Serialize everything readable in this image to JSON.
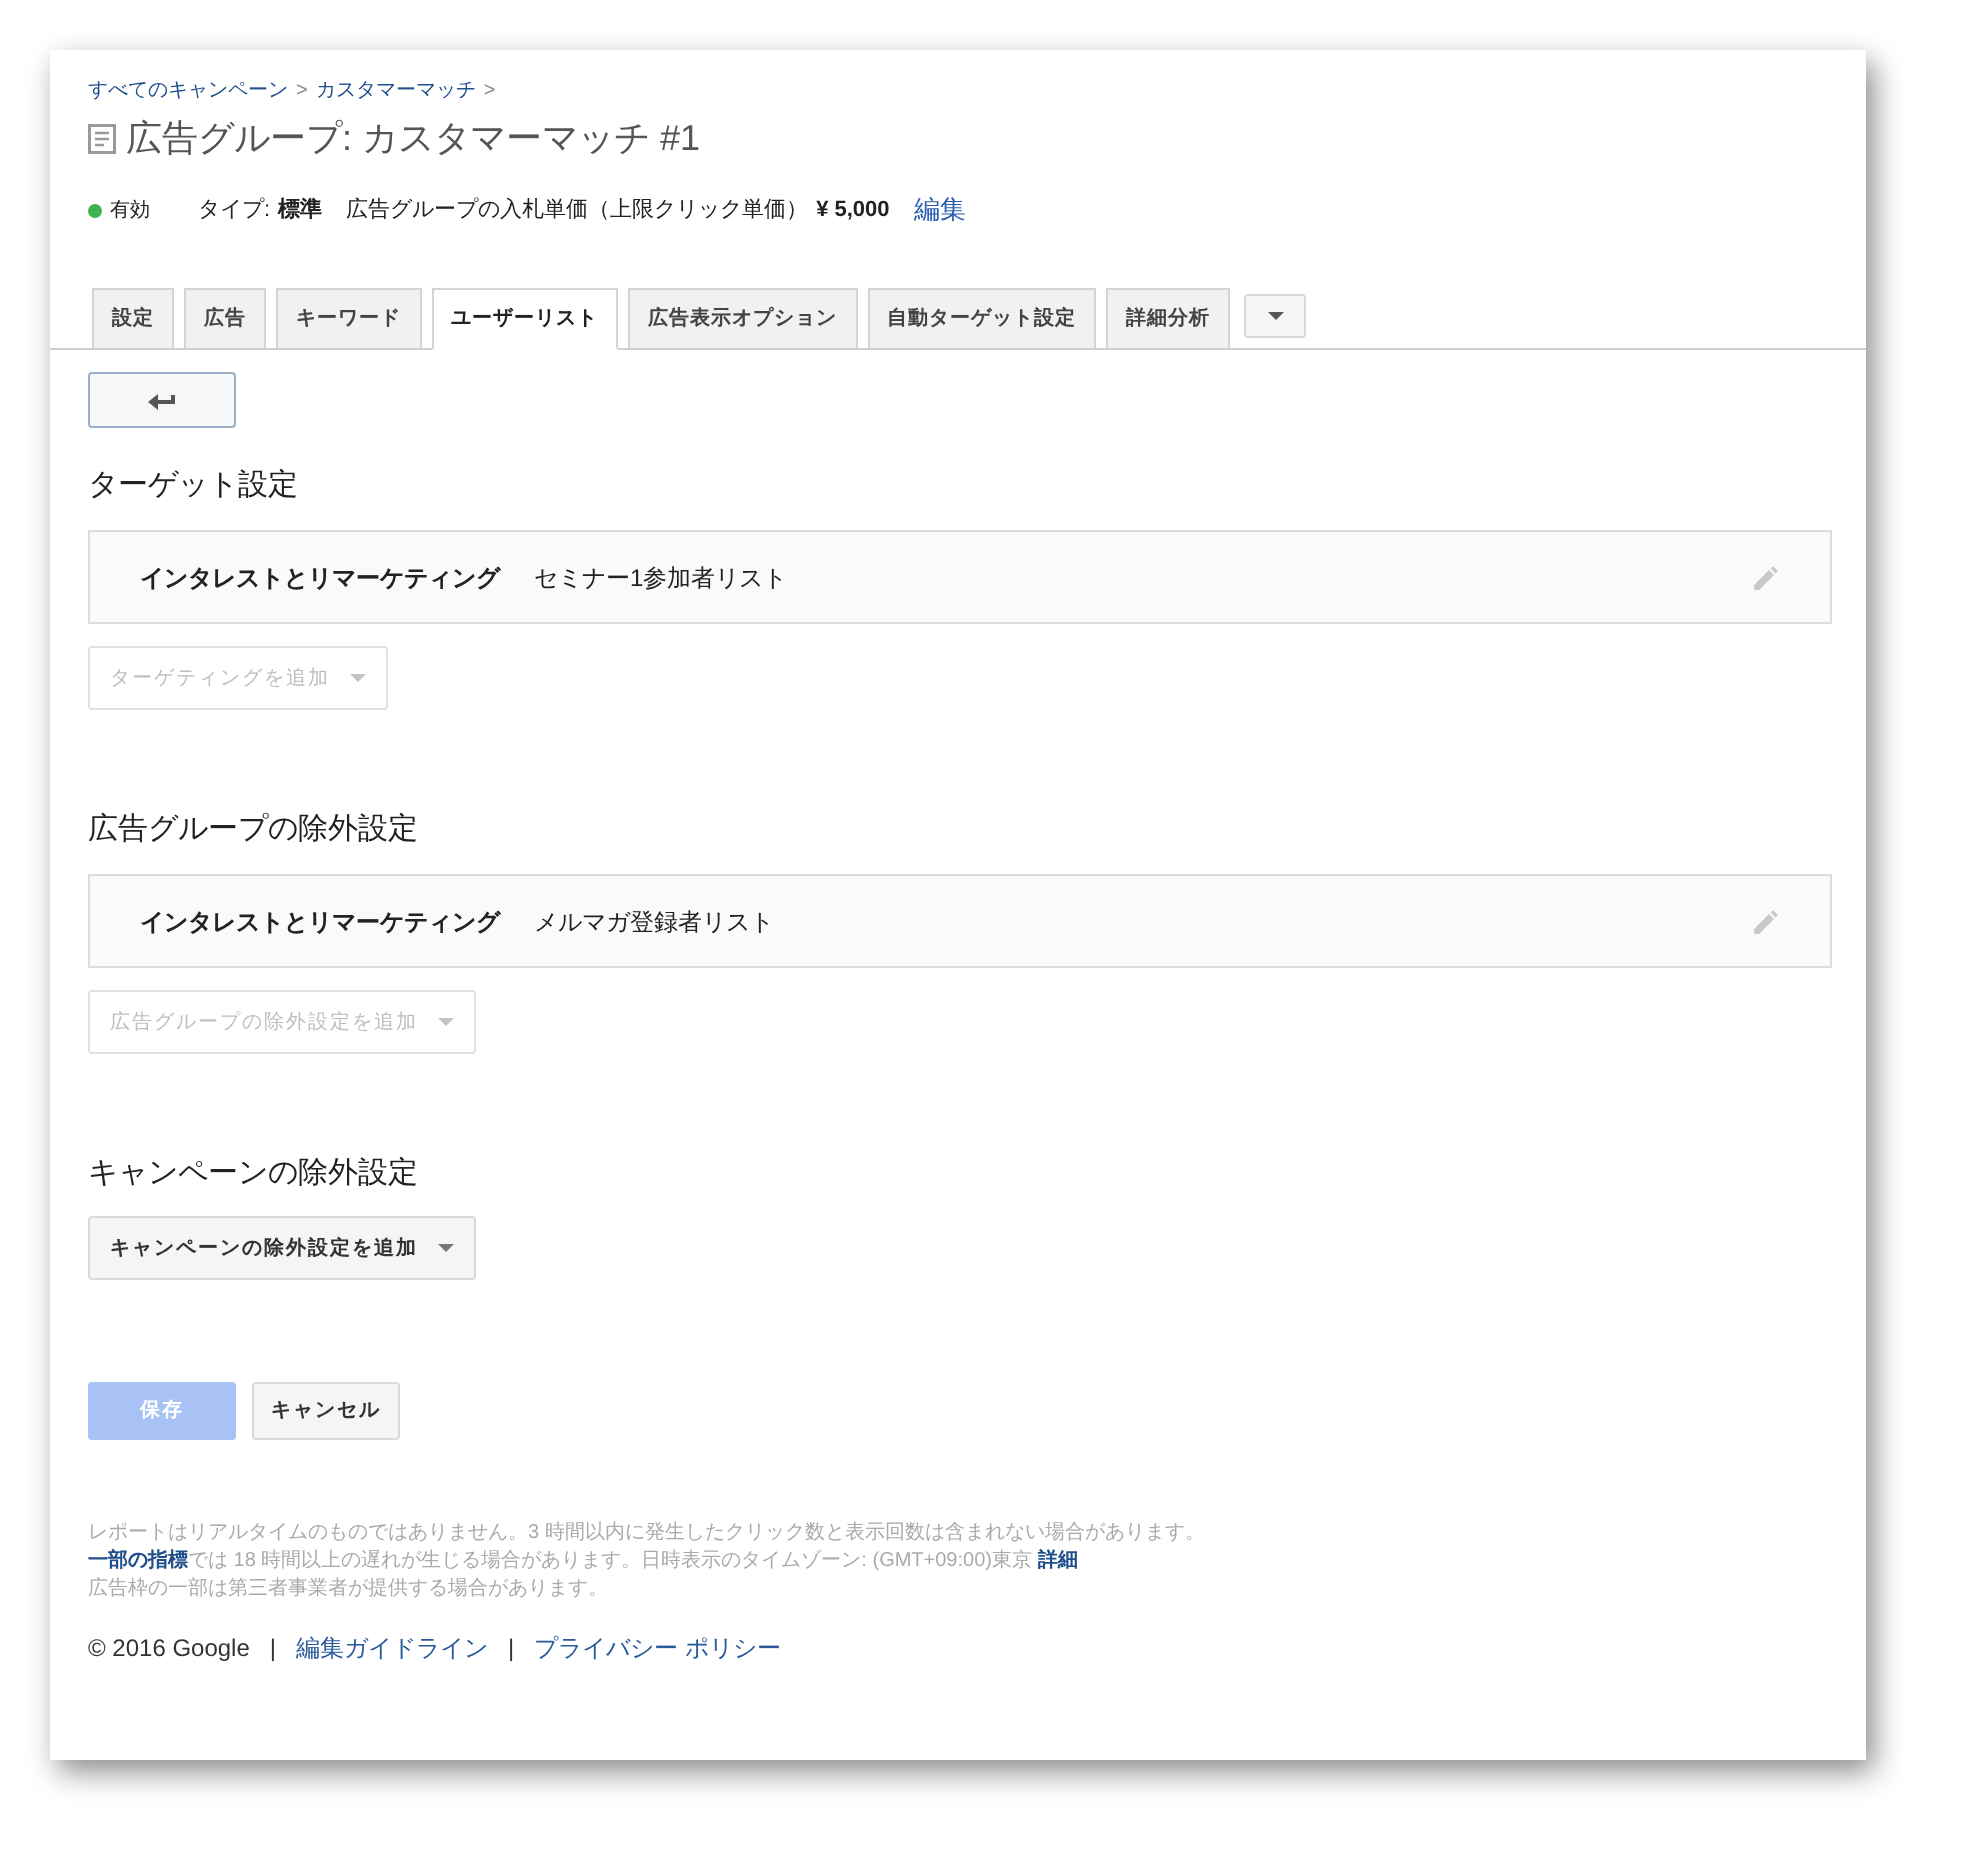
{
  "breadcrumb": [
    {
      "label": "すべてのキャンペーン",
      "separator": ">"
    },
    {
      "label": "カスタマーマッチ",
      "separator": ">"
    }
  ],
  "title": "広告グループ: カスタマーマッチ #1",
  "status_row": {
    "status": {
      "label": "有効",
      "enabled": true
    },
    "type": {
      "label": "タイプ:",
      "value": "標準"
    },
    "bid": {
      "label": "広告グループの入札単価（上限クリック単価）",
      "value": "¥ 5,000"
    },
    "edit_link": "編集"
  },
  "tabs": [
    {
      "label": "設定",
      "selected": false
    },
    {
      "label": "広告",
      "selected": false
    },
    {
      "label": "キーワード",
      "selected": false
    },
    {
      "label": "ユーザーリスト",
      "selected": true
    },
    {
      "label": "広告表示オプション",
      "selected": false
    },
    {
      "label": "自動ターゲット設定",
      "selected": false
    },
    {
      "label": "詳細分析",
      "selected": false
    }
  ],
  "sections": [
    {
      "heading": "ターゲット設定",
      "entries": [
        {
          "category": "インタレストとリマーケティング",
          "value": "セミナー1参加者リスト"
        }
      ],
      "add_button": {
        "label": "ターゲティングを追加",
        "disabled": true
      }
    },
    {
      "heading": "広告グループの除外設定",
      "entries": [
        {
          "category": "インタレストとリマーケティング",
          "value": "メルマガ登録者リスト"
        }
      ],
      "add_button": {
        "label": "広告グループの除外設定を追加",
        "disabled": true
      }
    },
    {
      "heading": "キャンペーンの除外設定",
      "add_button": {
        "label": "キャンペーンの除外設定を追加",
        "disabled": false
      }
    }
  ],
  "actions": {
    "save": {
      "label": "保存",
      "disabled": true
    },
    "cancel": {
      "label": "キャンセル"
    }
  },
  "footer_notes": [
    [
      {
        "kind": "text",
        "text": "レポートはリアルタイムのものではありません。3 時間以内に発生したクリック数と表示回数は含まれない場合があります。"
      }
    ],
    [
      {
        "kind": "link",
        "text": "一部の指標"
      },
      {
        "kind": "text",
        "text": "では 18 時間以上の遅れが生じる場合があります。日時表示のタイムゾーン: (GMT+09:00)東京 "
      },
      {
        "kind": "link",
        "text": "詳細"
      }
    ],
    [
      {
        "kind": "text",
        "text": "広告枠の一部は第三者事業者が提供する場合があります。"
      }
    ]
  ],
  "copyright": {
    "text": "© 2016 Google",
    "links": [
      {
        "separator": "|",
        "label": "編集ガイドライン"
      },
      {
        "separator": "|",
        "label": "プライバシー ポリシー"
      }
    ]
  }
}
